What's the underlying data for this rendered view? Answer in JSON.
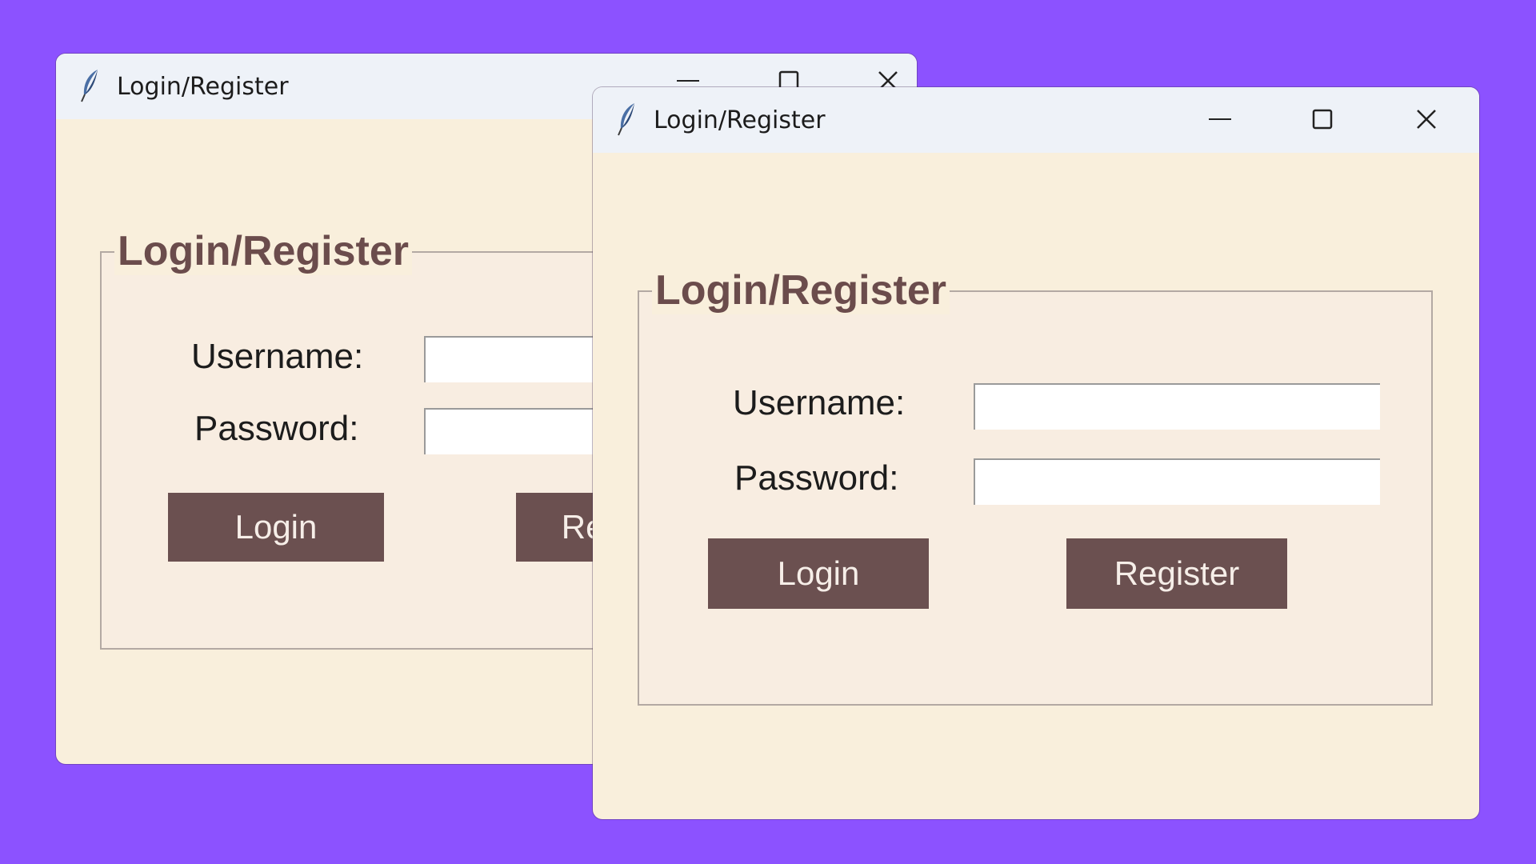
{
  "colors": {
    "desktop_background": "#8c52ff",
    "window_background": "#f9efdc",
    "titlebar_background": "#eef2f8",
    "accent": "#6b4c4c",
    "button_background": "#6b5050",
    "button_text": "#f6eee8"
  },
  "windows": [
    {
      "title": "Login/Register",
      "app_icon": "feather-icon",
      "controls": [
        "minimize-icon",
        "maximize-icon",
        "close-icon"
      ],
      "form": {
        "legend": "Login/Register",
        "username_label": "Username:",
        "username_value": "",
        "password_label": "Password:",
        "password_value": "",
        "login_button": "Login",
        "register_button": "Register"
      }
    },
    {
      "title": "Login/Register",
      "app_icon": "feather-icon",
      "controls": [
        "minimize-icon",
        "maximize-icon",
        "close-icon"
      ],
      "form": {
        "legend": "Login/Register",
        "username_label": "Username:",
        "username_value": "",
        "password_label": "Password:",
        "password_value": "",
        "login_button": "Login",
        "register_button": "Register"
      }
    }
  ]
}
